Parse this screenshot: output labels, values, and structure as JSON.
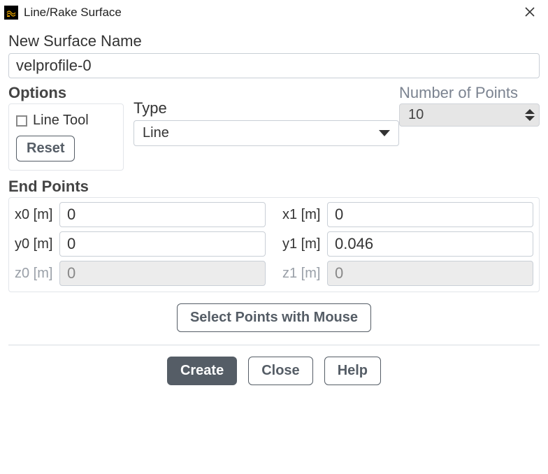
{
  "window": {
    "title": "Line/Rake Surface"
  },
  "surface": {
    "label": "New Surface Name",
    "value": "velprofile-0"
  },
  "options": {
    "heading": "Options",
    "line_tool_label": "Line Tool",
    "line_tool_checked": false,
    "reset_label": "Reset"
  },
  "type": {
    "label": "Type",
    "value": "Line"
  },
  "points": {
    "label": "Number of Points",
    "value": "10"
  },
  "endpoints": {
    "heading": "End Points",
    "x0": {
      "label": "x0 [m]",
      "value": "0",
      "enabled": true
    },
    "y0": {
      "label": "y0 [m]",
      "value": "0",
      "enabled": true
    },
    "z0": {
      "label": "z0 [m]",
      "value": "0",
      "enabled": false
    },
    "x1": {
      "label": "x1 [m]",
      "value": "0",
      "enabled": true
    },
    "y1": {
      "label": "y1 [m]",
      "value": "0.046",
      "enabled": true
    },
    "z1": {
      "label": "z1 [m]",
      "value": "0",
      "enabled": false
    }
  },
  "buttons": {
    "select_mouse": "Select Points with Mouse",
    "create": "Create",
    "close": "Close",
    "help": "Help"
  }
}
